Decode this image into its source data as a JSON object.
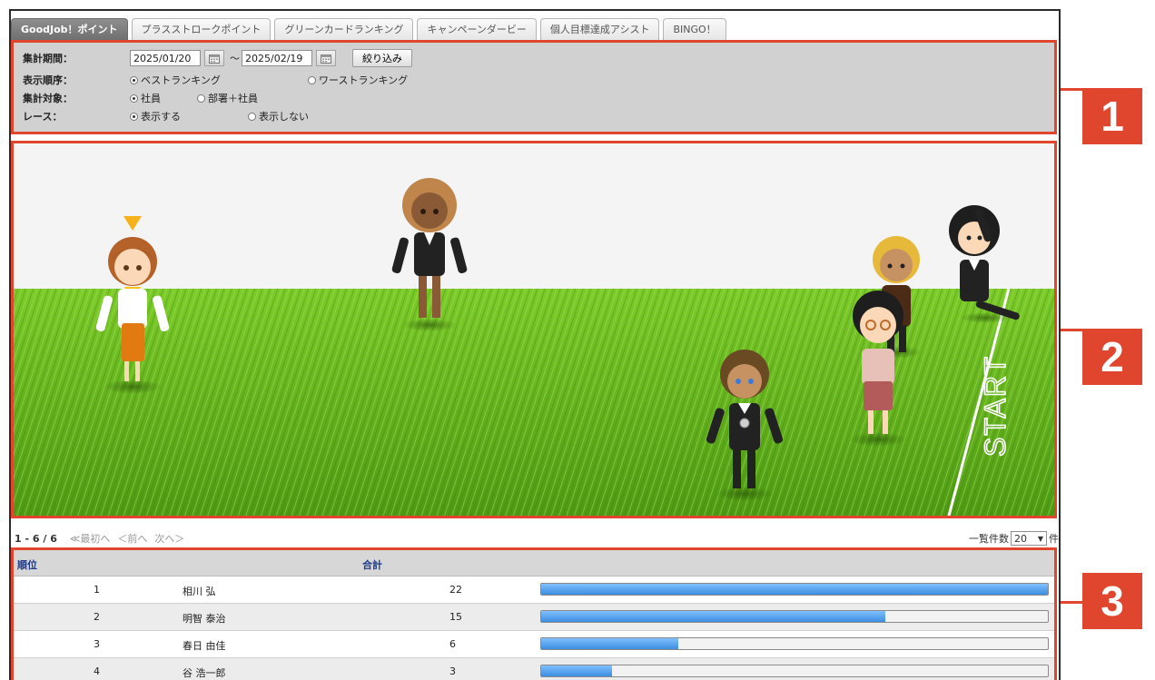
{
  "tabs": [
    {
      "label": "GoodJob！ポイント",
      "active": true
    },
    {
      "label": "プラスストロークポイント",
      "active": false
    },
    {
      "label": "グリーンカードランキング",
      "active": false
    },
    {
      "label": "キャンペーンダービー",
      "active": false
    },
    {
      "label": "個人目標達成アシスト",
      "active": false
    },
    {
      "label": "BINGO！",
      "active": false
    }
  ],
  "filter": {
    "period_label": "集計期間：",
    "date_from": "2025/01/20",
    "date_to": "2025/02/19",
    "tilde": "～",
    "submit_label": "絞り込み",
    "order_label": "表示順序：",
    "order_best": "ベストランキング",
    "order_worst": "ワーストランキング",
    "order_selected": "best",
    "target_label": "集計対象：",
    "target_employee": "社員",
    "target_dept": "部署＋社員",
    "target_selected": "employee",
    "race_label": "レース：",
    "race_show": "表示する",
    "race_hide": "表示しない",
    "race_selected": "show"
  },
  "race": {
    "start_label": "START",
    "colors": {
      "sky": "#f4f4f4",
      "grass_light": "#7ccb2a",
      "grass_dark": "#4e9a14",
      "marker": "#f6b21b"
    }
  },
  "pager": {
    "count": "1 - 6 / 6",
    "first": "≪最初へ",
    "prev": "＜前へ",
    "next": "次へ＞",
    "per_page_label": "一覧件数",
    "per_page_value": "20",
    "per_page_unit": "件"
  },
  "table": {
    "col_rank": "順位",
    "col_total": "合計",
    "rows": [
      {
        "rank": "1",
        "name": "相川 弘",
        "total": "22",
        "ratio": 1.0
      },
      {
        "rank": "2",
        "name": "明智 泰治",
        "total": "15",
        "ratio": 0.68
      },
      {
        "rank": "3",
        "name": "春日 由佳",
        "total": "6",
        "ratio": 0.27
      },
      {
        "rank": "4",
        "name": "谷 浩一郎",
        "total": "3",
        "ratio": 0.14
      }
    ]
  },
  "callouts": [
    "1",
    "2",
    "3"
  ]
}
